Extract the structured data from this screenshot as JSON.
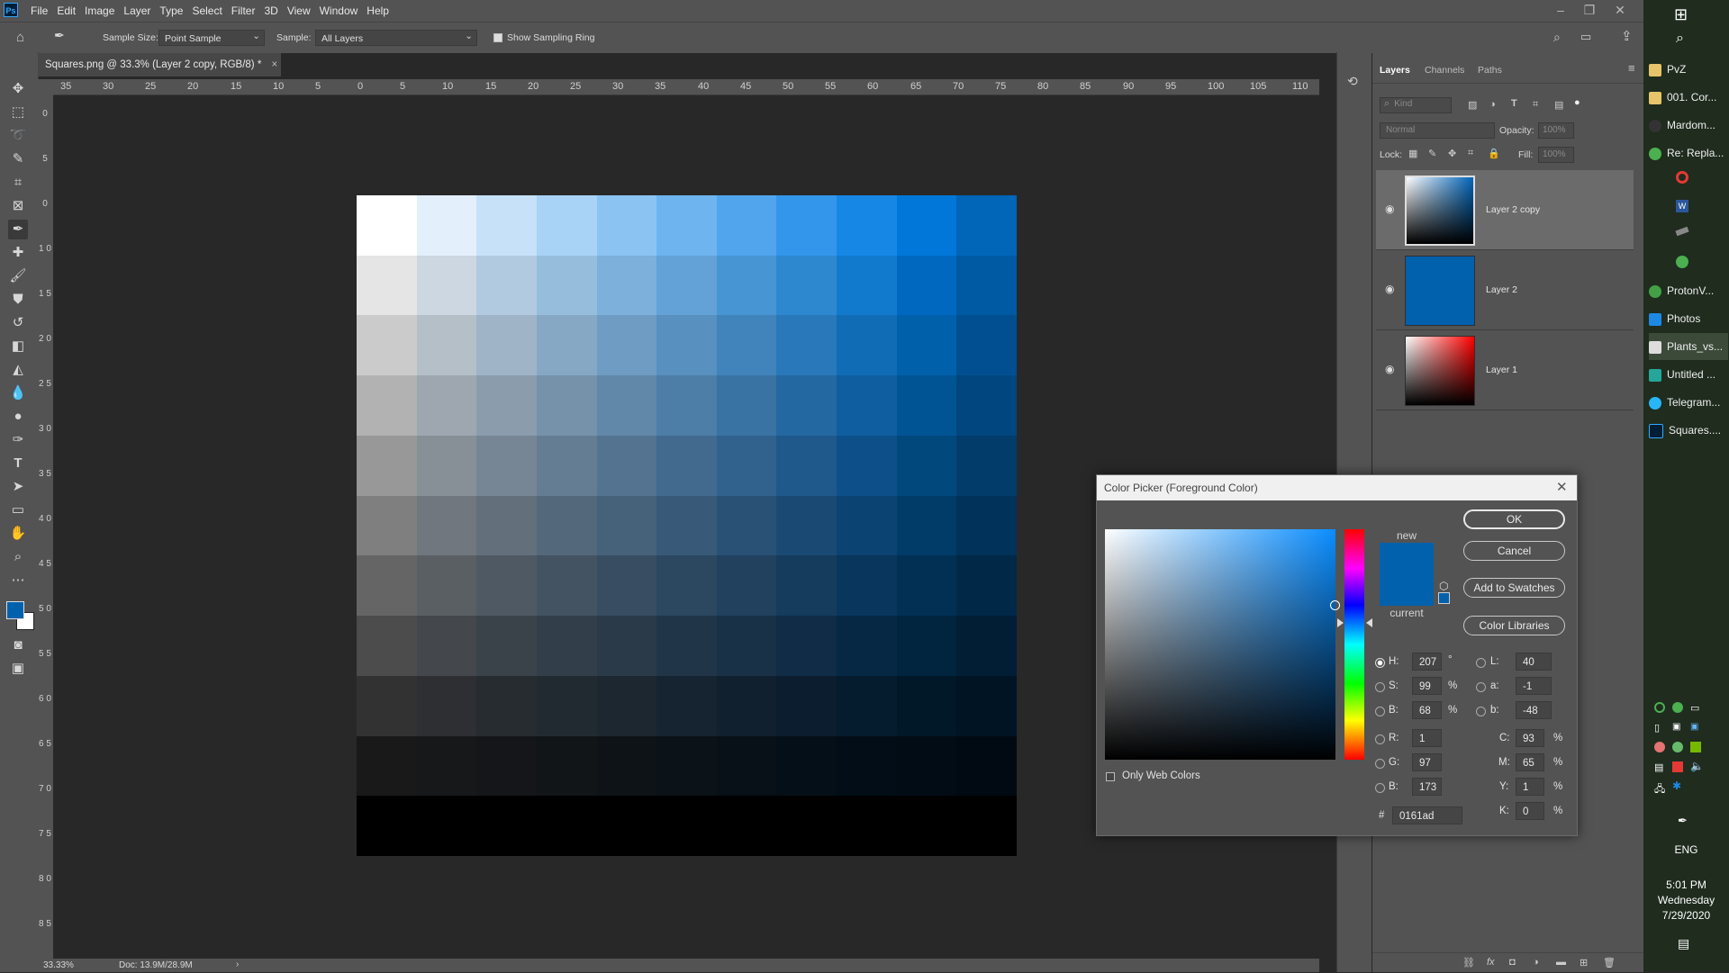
{
  "menubar": {
    "logo": "Ps",
    "items": [
      "File",
      "Edit",
      "Image",
      "Layer",
      "Type",
      "Select",
      "Filter",
      "3D",
      "View",
      "Window",
      "Help"
    ]
  },
  "options": {
    "sample_size_label": "Sample Size:",
    "sample_size_value": "Point Sample",
    "sample_label": "Sample:",
    "sample_value": "All Layers",
    "sampling_ring_label": "Show Sampling Ring"
  },
  "document": {
    "tab_title": "Squares.png @ 33.3% (Layer 2 copy, RGB/8) *",
    "ruler_h": [
      "35",
      "30",
      "25",
      "20",
      "15",
      "10",
      "5",
      "0",
      "5",
      "10",
      "15",
      "20",
      "25",
      "30",
      "35",
      "40",
      "45",
      "50",
      "55",
      "60",
      "65",
      "70",
      "75",
      "80",
      "85",
      "90",
      "95",
      "100",
      "105",
      "110"
    ],
    "ruler_v": [
      "0",
      "5",
      "0",
      "1 0",
      "1 5",
      "2 0",
      "2 5",
      "3 0",
      "3 5",
      "4 0",
      "4 5",
      "5 0",
      "5 5",
      "6 0",
      "6 5",
      "7 0",
      "7 5",
      "8 0",
      "8 5"
    ]
  },
  "grid_colors": [
    [
      "#ffffff",
      "#e3effb",
      "#c6e1f8",
      "#a8d2f6",
      "#8bc4f3",
      "#6eb5f0",
      "#50a5ed",
      "#3396ea",
      "#1787e6",
      "#0178d9",
      "#0165b8"
    ],
    [
      "#e5e5e5",
      "#ccd7e1",
      "#b2cae0",
      "#97bddd",
      "#7db0da",
      "#62a2d6",
      "#4795d3",
      "#2d88cf",
      "#127acc",
      "#0069bf",
      "#0059a3"
    ],
    [
      "#cbcbcb",
      "#b5bfc8",
      "#9fb4c7",
      "#87a8c4",
      "#6f9cc2",
      "#5890bf",
      "#4184bc",
      "#2978b9",
      "#116cb6",
      "#0060aa",
      "#014f90"
    ],
    [
      "#b2b2b2",
      "#9ea7af",
      "#8b9dad",
      "#7692ab",
      "#6188a9",
      "#4d7ea7",
      "#3973a4",
      "#2468a2",
      "#0f5e9f",
      "#015493",
      "#01467e"
    ],
    [
      "#989898",
      "#878f97",
      "#778695",
      "#657d93",
      "#547391",
      "#426a8f",
      "#31618d",
      "#1f588b",
      "#0d5089",
      "#01487d",
      "#013c6b"
    ],
    [
      "#7f7f7f",
      "#71777e",
      "#63707c",
      "#54687b",
      "#46617a",
      "#385978",
      "#295176",
      "#1a4a74",
      "#0b4373",
      "#013c69",
      "#013259"
    ],
    [
      "#656565",
      "#5a5f64",
      "#4f5963",
      "#435362",
      "#384d61",
      "#2c4760",
      "#21415e",
      "#153b5d",
      "#09365c",
      "#013054",
      "#012847"
    ],
    [
      "#4c4c4c",
      "#44474b",
      "#3b434a",
      "#323e49",
      "#2a3a48",
      "#213548",
      "#193147",
      "#102c46",
      "#072845",
      "#01243f",
      "#011e35"
    ],
    [
      "#323232",
      "#2d2f32",
      "#272c31",
      "#222a31",
      "#1c2730",
      "#162330",
      "#10202f",
      "#0b1d2e",
      "#051b2e",
      "#011829",
      "#011423"
    ],
    [
      "#191919",
      "#161819",
      "#141619",
      "#111518",
      "#0e1318",
      "#0b1218",
      "#081018",
      "#050f17",
      "#020d17",
      "#010c15",
      "#010a12"
    ],
    [
      "#000000",
      "#000000",
      "#000000",
      "#000000",
      "#000000",
      "#000000",
      "#000000",
      "#000000",
      "#000000",
      "#000000",
      "#000000"
    ]
  ],
  "statusbar": {
    "zoom": "33.33%",
    "doc": "Doc: 13.9M/28.9M"
  },
  "layers_panel": {
    "tabs": [
      "Layers",
      "Channels",
      "Paths"
    ],
    "kind_placeholder": "Kind",
    "blend_mode": "Normal",
    "opacity_label": "Opacity:",
    "opacity_value": "100%",
    "lock_label": "Lock:",
    "fill_label": "Fill:",
    "fill_value": "100%",
    "layers": [
      {
        "name": "Layer 2 copy",
        "selected": true
      },
      {
        "name": "Layer 2",
        "selected": false
      },
      {
        "name": "Layer 1",
        "selected": false
      }
    ]
  },
  "color_picker": {
    "title": "Color Picker (Foreground Color)",
    "new_label": "new",
    "current_label": "current",
    "new_color": "#0161ad",
    "current_color": "#0161ad",
    "buttons": {
      "ok": "OK",
      "cancel": "Cancel",
      "add_swatches": "Add to Swatches",
      "libraries": "Color Libraries"
    },
    "only_web": "Only Web Colors",
    "fields": {
      "H": "207",
      "S": "99",
      "Bv": "68",
      "R": "1",
      "G": "97",
      "Bl": "173",
      "L": "40",
      "a": "-1",
      "b": "-48",
      "C": "93",
      "M": "65",
      "Y": "1",
      "K": "0",
      "hex": "0161ad"
    },
    "labels": {
      "H": "H:",
      "S": "S:",
      "Bv": "B:",
      "R": "R:",
      "G": "G:",
      "Bl": "B:",
      "L": "L:",
      "a": "a:",
      "b": "b:",
      "C": "C:",
      "M": "M:",
      "Y": "Y:",
      "K": "K:",
      "hash": "#"
    },
    "units": {
      "deg": "°",
      "pct": "%"
    }
  },
  "taskbar": {
    "items": [
      "PvZ",
      "001. Cor...",
      "Mardom...",
      "Re: Repla...",
      "ProtonV...",
      "Photos",
      "Plants_vs...",
      "Untitled ...",
      "Telegram...",
      "Squares...."
    ],
    "lang": "ENG",
    "time": "5:01 PM",
    "day": "Wednesday",
    "date": "7/29/2020"
  }
}
